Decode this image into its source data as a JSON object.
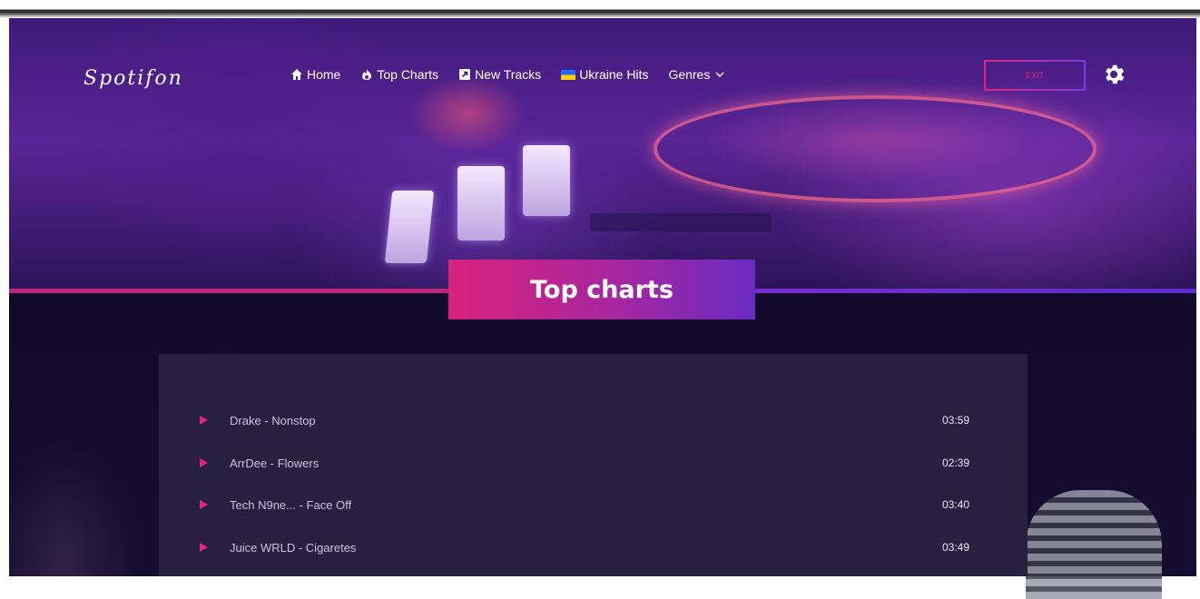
{
  "app": {
    "logo": "Spotifon"
  },
  "nav": {
    "items": [
      {
        "label": "Home",
        "icon": "home-icon"
      },
      {
        "label": "Top Charts",
        "icon": "fire-icon"
      },
      {
        "label": "New Tracks",
        "icon": "arrow-box-icon"
      },
      {
        "label": "Ukraine Hits",
        "icon": "ukraine-flag-icon"
      },
      {
        "label": "Genres",
        "icon": "chevron-down-icon"
      }
    ]
  },
  "header": {
    "exit_label": "EXIT",
    "settings_icon": "gear-icon"
  },
  "page": {
    "title": "Top charts"
  },
  "tracks": [
    {
      "title": "Drake - Nonstop",
      "duration": "03:59"
    },
    {
      "title": "ArrDee - Flowers",
      "duration": "02:39"
    },
    {
      "title": "Tech N9ne... - Face Off",
      "duration": "03:40"
    },
    {
      "title": "Juice WRLD - Cigaretes",
      "duration": "03:49"
    }
  ],
  "colors": {
    "accent_pink": "#e0267f",
    "accent_purple": "#6a2bc4",
    "panel_bg": "#28203f",
    "page_bg": "#140b2b"
  }
}
